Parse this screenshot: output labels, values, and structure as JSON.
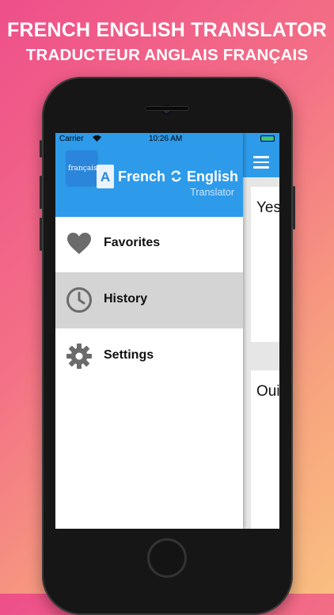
{
  "headline": {
    "line1": "FRENCH ENGLISH TRANSLATOR",
    "line2": "TRADUCTEUR ANGLAIS FRANÇAIS"
  },
  "status_bar": {
    "carrier": "Carrier",
    "time": "10:26 AM"
  },
  "drawer": {
    "logo": {
      "flag_text": "français",
      "a_letter": "A",
      "title_left": "French",
      "title_right": "English",
      "subtitle": "Translator"
    },
    "items": [
      {
        "label": "Favorites",
        "icon": "heart-icon",
        "selected": false
      },
      {
        "label": "History",
        "icon": "clock-icon",
        "selected": true
      },
      {
        "label": "Settings",
        "icon": "gear-icon",
        "selected": false
      }
    ]
  },
  "main": {
    "cards": [
      {
        "text": "Yes"
      },
      {
        "text": "Oui"
      }
    ]
  },
  "colors": {
    "accent": "#2d9bea",
    "selected_row": "#d4d4d4",
    "icon_gray": "#6b6b6b"
  }
}
